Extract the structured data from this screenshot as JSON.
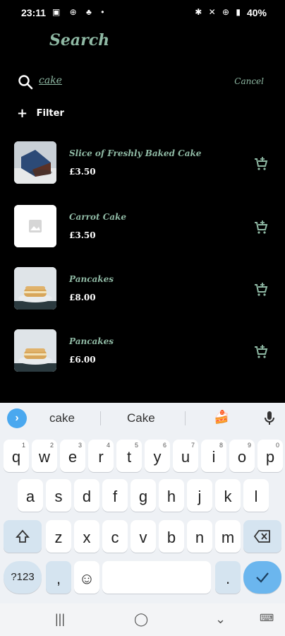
{
  "status": {
    "time": "23:11",
    "left_icons": "▣ ⊕ ♣ •",
    "right_icons": "✱ ✕ ⊕ ▮",
    "battery": "40%"
  },
  "header": {
    "title": "Search"
  },
  "search": {
    "value": "cake",
    "cancel_label": "Cancel"
  },
  "filter": {
    "label": "Filter"
  },
  "results": [
    {
      "name": "Slice of Freshly Baked Cake",
      "price": "£3.50",
      "thumb": "cake-photo"
    },
    {
      "name": "Carrot Cake",
      "price": "£3.50",
      "thumb": "placeholder"
    },
    {
      "name": "Pancakes",
      "price": "£8.00",
      "thumb": "pancake-photo"
    },
    {
      "name": "Pancakes",
      "price": "£6.00",
      "thumb": "pancake-photo"
    }
  ],
  "keyboard": {
    "suggestions": [
      "cake",
      "Cake"
    ],
    "row1": [
      "q",
      "w",
      "e",
      "r",
      "t",
      "y",
      "u",
      "i",
      "o",
      "p"
    ],
    "row1_sup": [
      "1",
      "2",
      "3",
      "4",
      "5",
      "6",
      "7",
      "8",
      "9",
      "0"
    ],
    "row2": [
      "a",
      "s",
      "d",
      "f",
      "g",
      "h",
      "j",
      "k",
      "l"
    ],
    "row3": [
      "z",
      "x",
      "c",
      "v",
      "b",
      "n",
      "m"
    ],
    "symbols_label": "?123",
    "comma": ",",
    "period": "."
  },
  "colors": {
    "accent": "#8fb9a4",
    "keyboard_action": "#6bb6ee"
  }
}
